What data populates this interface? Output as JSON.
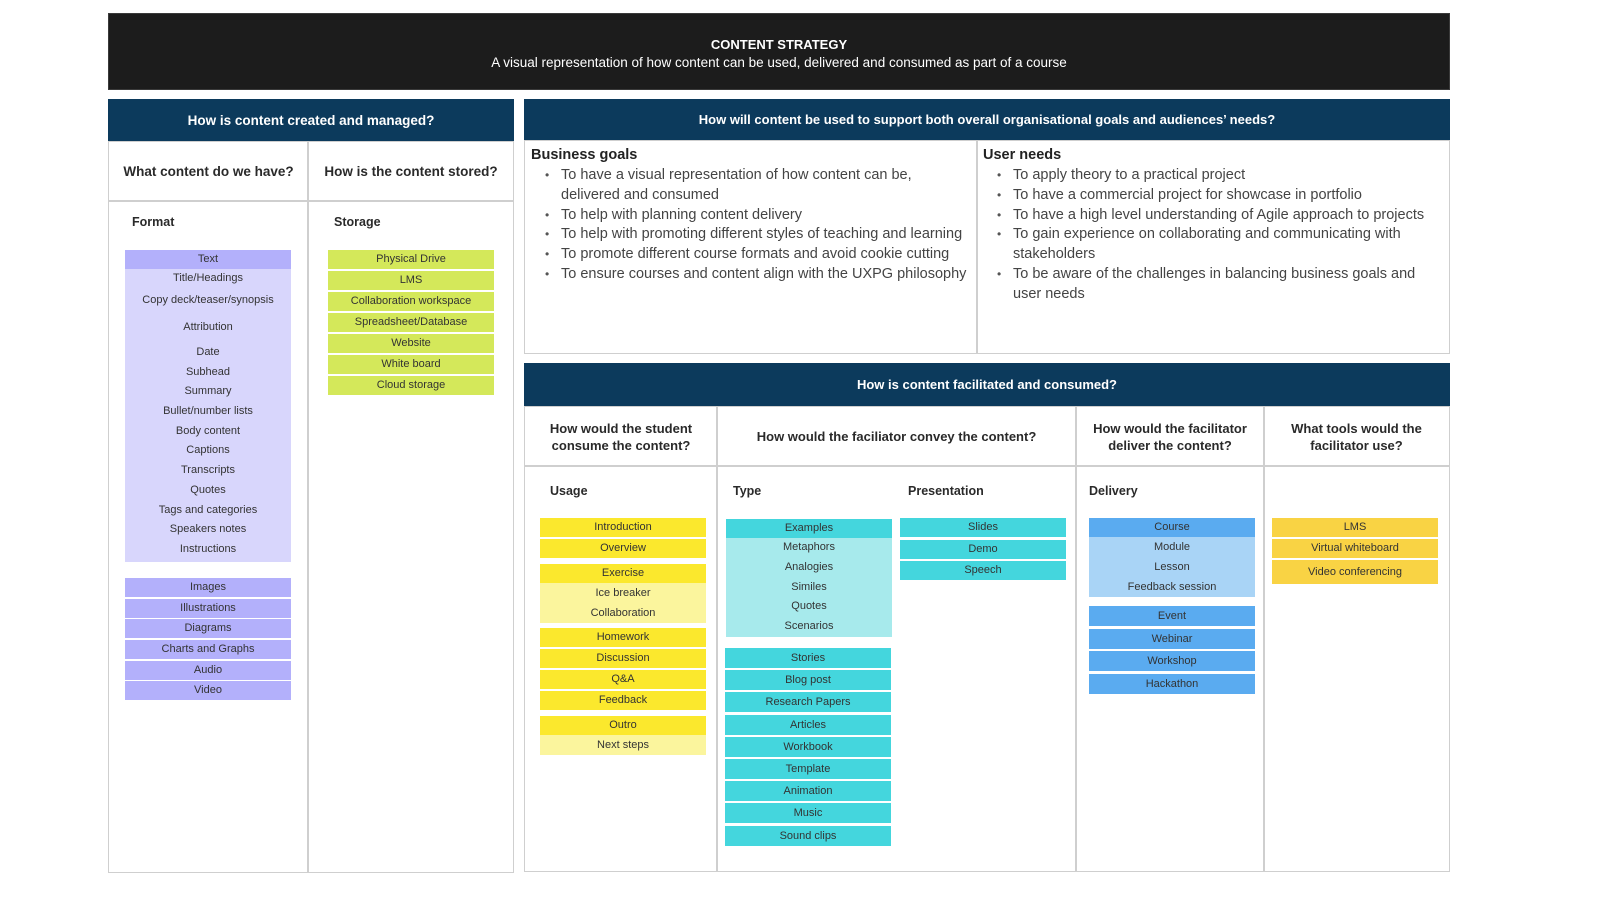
{
  "banner": {
    "title": "CONTENT STRATEGY",
    "subtitle": "A visual representation of how content can be used, delivered and consumed as part of a course"
  },
  "created": {
    "header": "How is content created and managed?",
    "col1": {
      "question": "What content do we have?",
      "label": "Format",
      "text_group": {
        "title": "Text",
        "items": [
          "Title/Headings",
          "Copy deck/teaser/synopsis",
          "Attribution",
          "Date",
          "Subhead",
          "Summary",
          "Bullet/number lists",
          "Body content",
          "Captions",
          "Transcripts",
          "Quotes",
          "Tags and categories",
          "Speakers notes",
          "Instructions"
        ]
      },
      "media": [
        "Images",
        "Illustrations",
        "Diagrams",
        "Charts and Graphs",
        "Audio",
        "Video"
      ]
    },
    "col2": {
      "question": "How is the content stored?",
      "label": "Storage",
      "items": [
        "Physical Drive",
        "LMS",
        "Collaboration workspace",
        "Spreadsheet/Database",
        "Website",
        "White board",
        "Cloud storage"
      ]
    }
  },
  "goals": {
    "header": "How will content be used to support both overall organisational goals and audiences’ needs?",
    "business": {
      "title": "Business goals",
      "items": [
        "To have a visual representation of how content can be, delivered and consumed",
        "To help with planning content delivery",
        "To help with promoting different styles of teaching and learning",
        "To promote different course formats and avoid cookie cutting",
        "To ensure courses and content align with the UXPG philosophy"
      ]
    },
    "user": {
      "title": "User needs",
      "items": [
        "To apply theory to a practical project",
        "To have a commercial project for showcase in portfolio",
        "To have a high level understanding of Agile approach to projects",
        "To gain experience on collaborating and communicating with stakeholders",
        "To be aware of the challenges in balancing business goals and user needs"
      ]
    }
  },
  "facilitated": {
    "header": "How is content facilitated and consumed?",
    "student": {
      "question": "How would the student consume the content?",
      "label": "Usage",
      "groups": [
        {
          "title": "Introduction",
          "items": []
        },
        {
          "title": "Overview",
          "items": []
        },
        {
          "title": "Exercise",
          "items": [
            "Ice breaker",
            "Collaboration"
          ]
        },
        {
          "title": "Homework",
          "items": []
        },
        {
          "title": "Discussion",
          "items": []
        },
        {
          "title": "Q&A",
          "items": []
        },
        {
          "title": "Feedback",
          "items": []
        },
        {
          "title": "Outro",
          "items": [
            "Next steps"
          ]
        }
      ]
    },
    "convey": {
      "question": "How would the faciliator convey the content?",
      "type_label": "Type",
      "type_group": {
        "title": "Examples",
        "items": [
          "Metaphors",
          "Analogies",
          "Similes",
          "Quotes",
          "Scenarios"
        ]
      },
      "type_items": [
        "Stories",
        "Blog post",
        "Research Papers",
        "Articles",
        "Workbook",
        "Template",
        "Animation",
        "Music",
        "Sound clips"
      ],
      "presentation_label": "Presentation",
      "presentation_items": [
        "Slides",
        "Demo",
        "Speech"
      ]
    },
    "deliver": {
      "question": "How would the facilitator deliver the content?",
      "label": "Delivery",
      "course_group": {
        "title": "Course",
        "items": [
          "Module",
          "Lesson",
          "Feedback session"
        ]
      },
      "items": [
        "Event",
        "Webinar",
        "Workshop",
        "Hackathon"
      ]
    },
    "tools": {
      "question": "What tools would the facilitator use?",
      "items": [
        "LMS",
        "Virtual whiteboard",
        "Video conferencing"
      ]
    }
  },
  "colors": {
    "navy": "#0c3a5c",
    "banner": "#1c1c1c",
    "purple_strong": "#b3b0fb",
    "purple_light": "#d8d6fc",
    "lime": "#d4e85a",
    "yellow_strong": "#fbe82d",
    "yellow_light": "#fbf59d",
    "cyan_strong": "#44d6dd",
    "cyan_light": "#a7eaec",
    "blue_strong": "#5aabf0",
    "blue_light": "#a9d4f6",
    "amber": "#f9d344"
  }
}
